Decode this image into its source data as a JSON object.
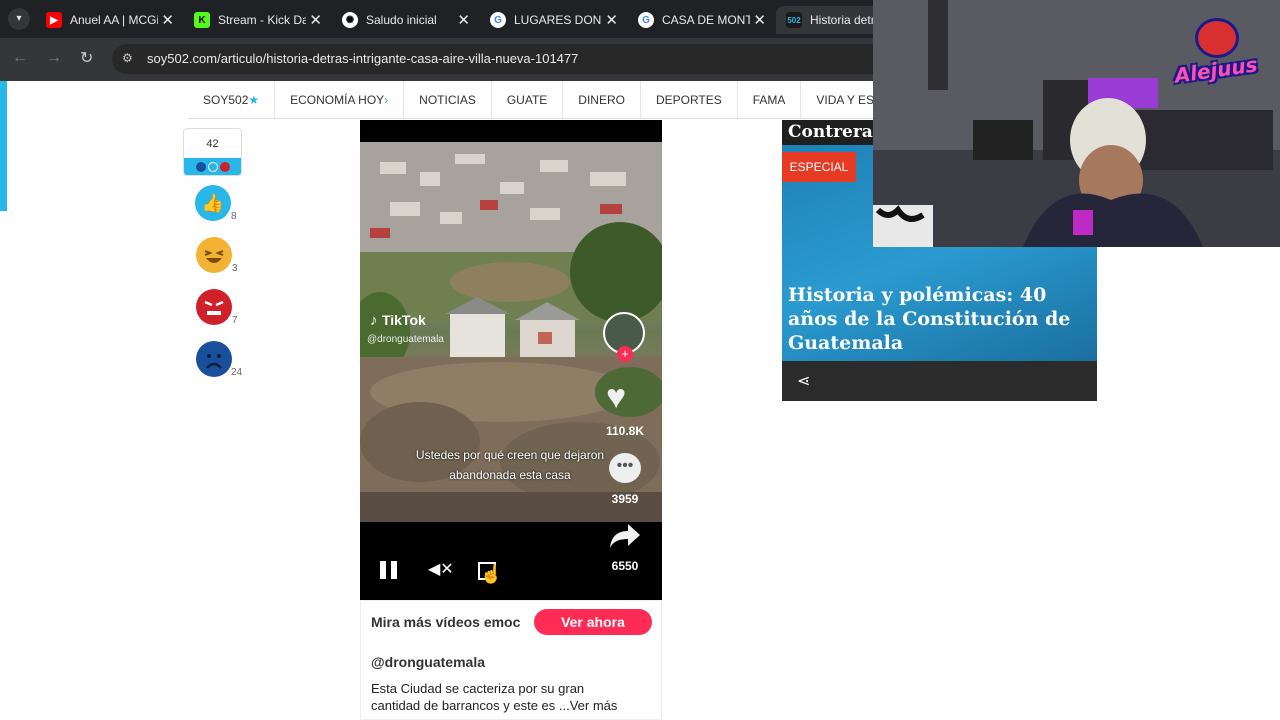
{
  "browser": {
    "tabs": [
      {
        "title": "Anuel AA | MCGi",
        "icon": "youtube-icon",
        "color": "#ff0000"
      },
      {
        "title": "Stream - Kick Da",
        "icon": "kick-icon",
        "color": "#53fc18"
      },
      {
        "title": "Saludo inicial",
        "icon": "chatgpt-icon",
        "color": "#ffffff"
      },
      {
        "title": "LUGARES DOND",
        "icon": "google-icon",
        "color": "#4285f4"
      },
      {
        "title": "CASA DE MONT",
        "icon": "google-icon",
        "color": "#4285f4"
      },
      {
        "title": "Historia detra",
        "icon": "soy502-icon",
        "color": "#29b6e8"
      }
    ],
    "url": "soy502.com/articulo/historia-detras-intrigante-casa-aire-villa-nueva-101477"
  },
  "nav": {
    "items": [
      "SOY502",
      "ECONOMÍA HOY",
      "NOTICIAS",
      "GUATE",
      "DINERO",
      "DEPORTES",
      "FAMA",
      "VIDA Y ESTI"
    ]
  },
  "reactions": {
    "total": "42",
    "items": [
      {
        "name": "like",
        "count": "8",
        "color": "#29b6e8"
      },
      {
        "name": "laugh",
        "count": "3",
        "color": "#f2b233"
      },
      {
        "name": "angry",
        "count": "7",
        "color": "#d0202a"
      },
      {
        "name": "sad",
        "count": "24",
        "color": "#1a4f9c"
      }
    ]
  },
  "video": {
    "brand": "TikTok",
    "handle": "@dronguatemala",
    "caption_line1": "Ustedes por qué creen que dejaron",
    "caption_line2": "abandonada esta casa",
    "likes": "110.8K",
    "comments": "3959",
    "shares": "6550",
    "more_text": "Mira más vídeos emoc",
    "cta": "Ver ahora",
    "author": "@dronguatemala",
    "desc_line1": "Esta Ciudad se cacteriza por su gran",
    "desc_line2": "cantidad de barrancos y este es ...Ver más"
  },
  "sidebar": {
    "heading": "Contreras",
    "badge": "ESPECIAL",
    "headline": "Historia y polémicas: 40 años de la Constitución de Guatemala"
  },
  "overlay": {
    "logo": "Alejuus"
  }
}
